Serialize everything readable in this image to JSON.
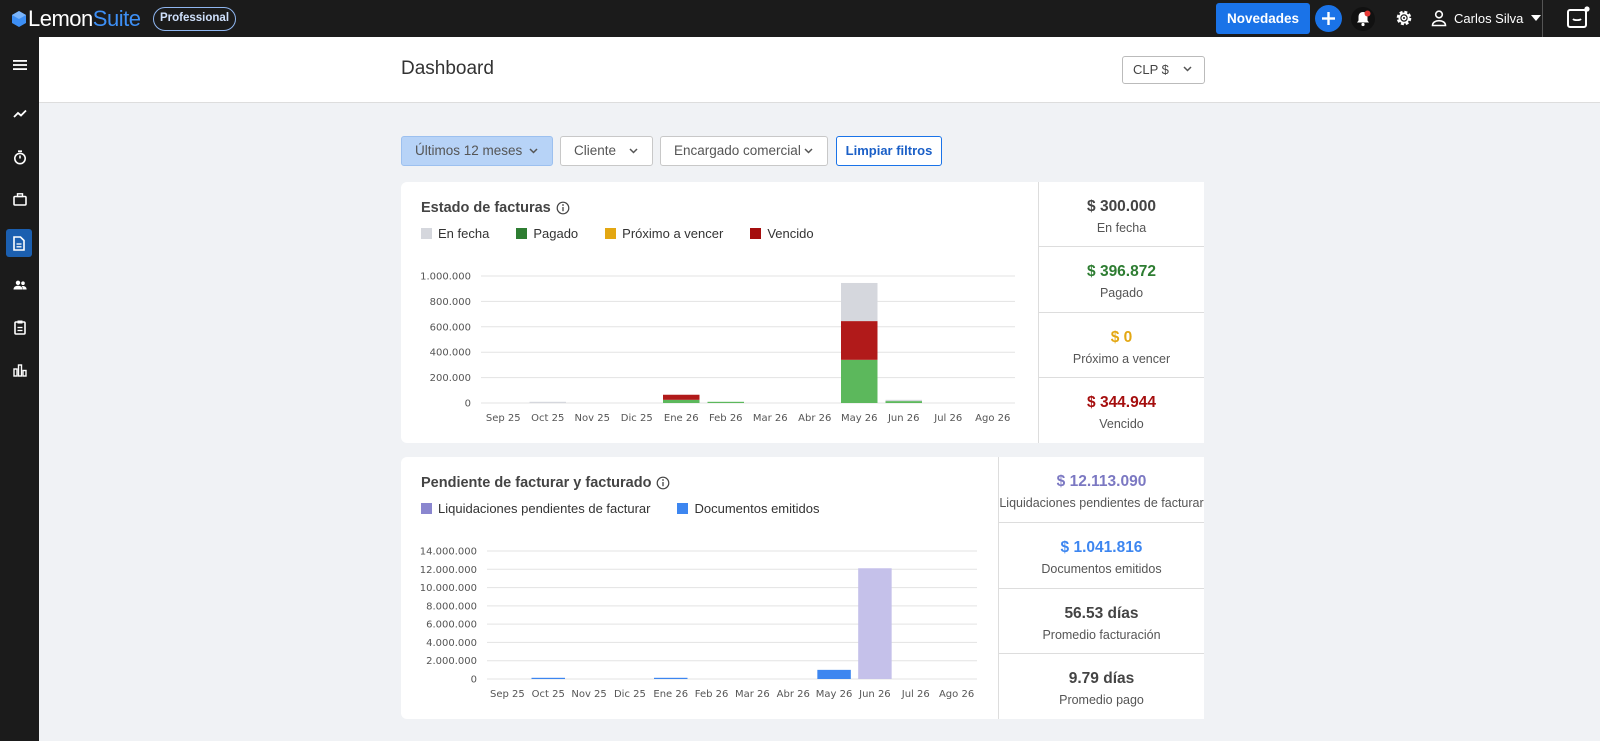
{
  "topbar": {
    "logo_lemon": "Lemon",
    "logo_suite": "Suite",
    "plan_badge": "Professional",
    "novedades_label": "Novedades",
    "user_name": "Carlos Silva"
  },
  "sidebar": {
    "items": [
      "menu-icon",
      "trend-icon",
      "timer-icon",
      "briefcase-icon",
      "document-icon",
      "users-icon",
      "clipboard-icon",
      "bar-chart-icon"
    ],
    "active": "document-icon"
  },
  "header": {
    "title": "Dashboard",
    "currency": "CLP $"
  },
  "filters": {
    "period": "Últimos 12 meses",
    "client": "Cliente",
    "manager": "Encargado comercial",
    "clear_label": "Limpiar filtros"
  },
  "colors": {
    "accent": "#1a73e8",
    "en_fecha": "#d5d7dd",
    "pagado": "#2e7d32",
    "proximo": "#e3a712",
    "vencido": "#a50e0e",
    "liquidaciones": "#8a86cf",
    "documentos": "#3d86f0"
  },
  "estado": {
    "title": "Estado de facturas",
    "legend": [
      "En fecha",
      "Pagado",
      "Próximo a vencer",
      "Vencido"
    ],
    "kpis": [
      {
        "value": "$ 300.000",
        "label": "En fecha",
        "color": "#444444"
      },
      {
        "value": "$ 396.872",
        "label": "Pagado",
        "color": "#2e7d32"
      },
      {
        "value": "$ 0",
        "label": "Próximo a vencer",
        "color": "#e3a712"
      },
      {
        "value": "$ 344.944",
        "label": "Vencido",
        "color": "#a50e0e"
      }
    ]
  },
  "pendiente": {
    "title": "Pendiente de facturar y facturado",
    "legend": [
      "Liquidaciones pendientes de facturar",
      "Documentos emitidos"
    ],
    "kpis": [
      {
        "value": "$ 12.113.090",
        "label": "Liquidaciones pendientes de facturar",
        "color": "#7b78c2"
      },
      {
        "value": "$ 1.041.816",
        "label": "Documentos emitidos",
        "color": "#3d86f0"
      },
      {
        "value": "56.53 días",
        "label": "Promedio facturación",
        "color": "#444444"
      },
      {
        "value": "9.79 días",
        "label": "Promedio pago",
        "color": "#444444"
      }
    ]
  },
  "chart_data": [
    {
      "type": "bar",
      "stacked": true,
      "title": "Estado de facturas",
      "categories": [
        "Sep 25",
        "Oct 25",
        "Nov 25",
        "Dic 25",
        "Ene 26",
        "Feb 26",
        "Mar 26",
        "Abr 26",
        "May 26",
        "Jun 26",
        "Jul 26",
        "Ago 26"
      ],
      "series": [
        {
          "name": "Pagado",
          "color": "#5cb85c",
          "values": [
            0,
            0,
            0,
            0,
            25000,
            8000,
            0,
            0,
            340000,
            15000,
            0,
            0
          ]
        },
        {
          "name": "Vencido",
          "color": "#b11a1a",
          "values": [
            0,
            0,
            0,
            0,
            40000,
            0,
            0,
            0,
            305000,
            0,
            0,
            0
          ]
        },
        {
          "name": "Próximo a vencer",
          "color": "#e3a712",
          "values": [
            0,
            0,
            0,
            0,
            0,
            0,
            0,
            0,
            0,
            0,
            0,
            0
          ]
        },
        {
          "name": "En fecha",
          "color": "#d5d7dd",
          "values": [
            0,
            2000,
            0,
            0,
            0,
            0,
            0,
            0,
            300000,
            10000,
            0,
            0
          ]
        }
      ],
      "yticks": [
        0,
        200000,
        400000,
        600000,
        800000,
        1000000
      ],
      "ytick_labels": [
        "0",
        "200.000",
        "400.000",
        "600.000",
        "800.000",
        "1.000.000"
      ],
      "ylim": [
        0,
        1000000
      ],
      "grid": true
    },
    {
      "type": "bar",
      "stacked": false,
      "title": "Pendiente de facturar y facturado",
      "categories": [
        "Sep 25",
        "Oct 25",
        "Nov 25",
        "Dic 25",
        "Ene 26",
        "Feb 26",
        "Mar 26",
        "Abr 26",
        "May 26",
        "Jun 26",
        "Jul 26",
        "Ago 26"
      ],
      "series": [
        {
          "name": "Documentos emitidos",
          "color": "#3d86f0",
          "values": [
            0,
            30000,
            0,
            0,
            20000,
            0,
            0,
            0,
            1000000,
            0,
            0,
            0
          ]
        },
        {
          "name": "Liquidaciones pendientes de facturar",
          "color": "#c5c1ea",
          "values": [
            0,
            0,
            0,
            0,
            0,
            0,
            0,
            0,
            0,
            12113090,
            0,
            0
          ]
        }
      ],
      "yticks": [
        0,
        2000000,
        4000000,
        6000000,
        8000000,
        10000000,
        12000000,
        14000000
      ],
      "ytick_labels": [
        "0",
        "2.000.000",
        "4.000.000",
        "6.000.000",
        "8.000.000",
        "10.000.000",
        "12.000.000",
        "14.000.000"
      ],
      "ylim": [
        0,
        14000000
      ],
      "grid": true
    }
  ]
}
